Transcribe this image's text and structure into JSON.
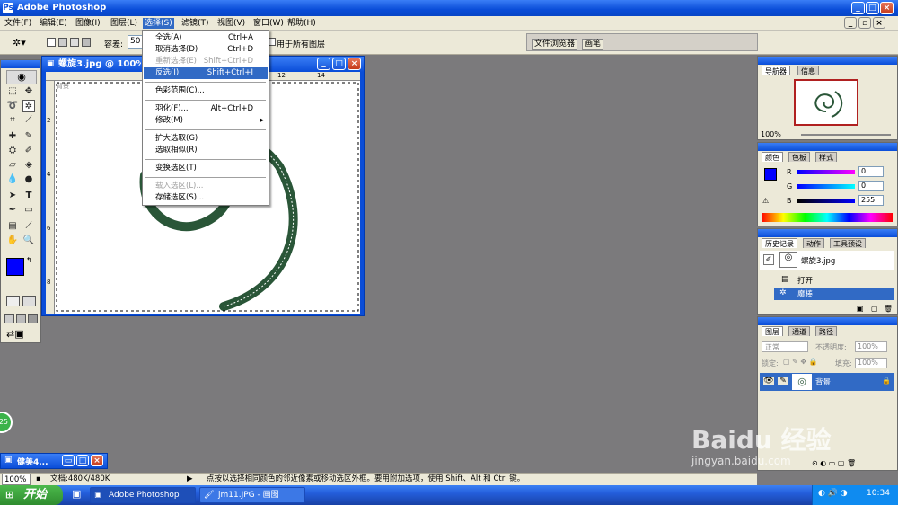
{
  "app": {
    "title": "Adobe Photoshop"
  },
  "menubar": [
    "文件(F)",
    "编辑(E)",
    "图像(I)",
    "图层(L)",
    "选择(S)",
    "滤镜(T)",
    "视图(V)",
    "窗口(W)",
    "帮助(H)"
  ],
  "options": {
    "tolerance_label": "容差:",
    "tolerance_value": "50",
    "all_layers": "用于所有图层",
    "file_browser": "文件浏览器",
    "brushes": "画笔"
  },
  "document": {
    "title": "螺旋3.jpg @ 100%",
    "ruler_top": [
      "14",
      "12",
      "14"
    ],
    "ruler_left": [
      "2",
      "4",
      "6",
      "8"
    ],
    "corner": "背景"
  },
  "select_menu": [
    {
      "label": "全选(A)",
      "shortcut": "Ctrl+A",
      "state": "normal"
    },
    {
      "label": "取消选择(D)",
      "shortcut": "Ctrl+D",
      "state": "normal"
    },
    {
      "label": "重新选择(E)",
      "shortcut": "Shift+Ctrl+D",
      "state": "disabled"
    },
    {
      "label": "反选(I)",
      "shortcut": "Shift+Ctrl+I",
      "state": "highlight"
    },
    {
      "label": "色彩范围(C)...",
      "shortcut": "",
      "state": "normal"
    },
    {
      "label": "羽化(F)...",
      "shortcut": "Alt+Ctrl+D",
      "state": "normal"
    },
    {
      "label": "修改(M)",
      "shortcut": "▸",
      "state": "normal"
    },
    {
      "label": "扩大选取(G)",
      "shortcut": "",
      "state": "normal"
    },
    {
      "label": "选取相似(R)",
      "shortcut": "",
      "state": "normal"
    },
    {
      "label": "变换选区(T)",
      "shortcut": "",
      "state": "normal"
    },
    {
      "label": "载入选区(L)...",
      "shortcut": "",
      "state": "disabled"
    },
    {
      "label": "存储选区(S)...",
      "shortcut": "",
      "state": "normal"
    }
  ],
  "navigator": {
    "tabs": [
      "导航器",
      "信息"
    ],
    "zoom": "100%"
  },
  "color": {
    "tabs": [
      "颜色",
      "色板",
      "样式"
    ],
    "r_label": "R",
    "g_label": "G",
    "b_label": "B",
    "r": "0",
    "g": "0",
    "b": "255",
    "fg": "#0000ff"
  },
  "history": {
    "tabs": [
      "历史记录",
      "动作",
      "工具预设"
    ],
    "snapshot": "螺旋3.jpg",
    "items": [
      "打开",
      "魔棒"
    ]
  },
  "layers": {
    "tabs": [
      "图层",
      "通道",
      "路径"
    ],
    "blend": "正常",
    "opacity_label": "不透明度:",
    "opacity": "100%",
    "lock_label": "锁定:",
    "fill_label": "填充:",
    "fill": "100%",
    "layer_name": "背景"
  },
  "minimized": {
    "title": "健美4..."
  },
  "status": {
    "zoom": "100%",
    "doc": "文档:480K/480K",
    "hint": "点按以选择相同颜色的邻近像素或移动选区外框。要用附加选项，使用 Shift、Alt 和 Ctrl 键。"
  },
  "badge": "25",
  "taskbar": {
    "start": "开始",
    "items": [
      "Adobe Photoshop",
      "jm11.JPG - 画图"
    ],
    "clock": "10:34"
  },
  "watermark": {
    "brand": "Baidu 经验",
    "url": "jingyan.baidu.com"
  },
  "colors": {
    "spiral": "#2a5638",
    "accent": "#316ac5"
  }
}
